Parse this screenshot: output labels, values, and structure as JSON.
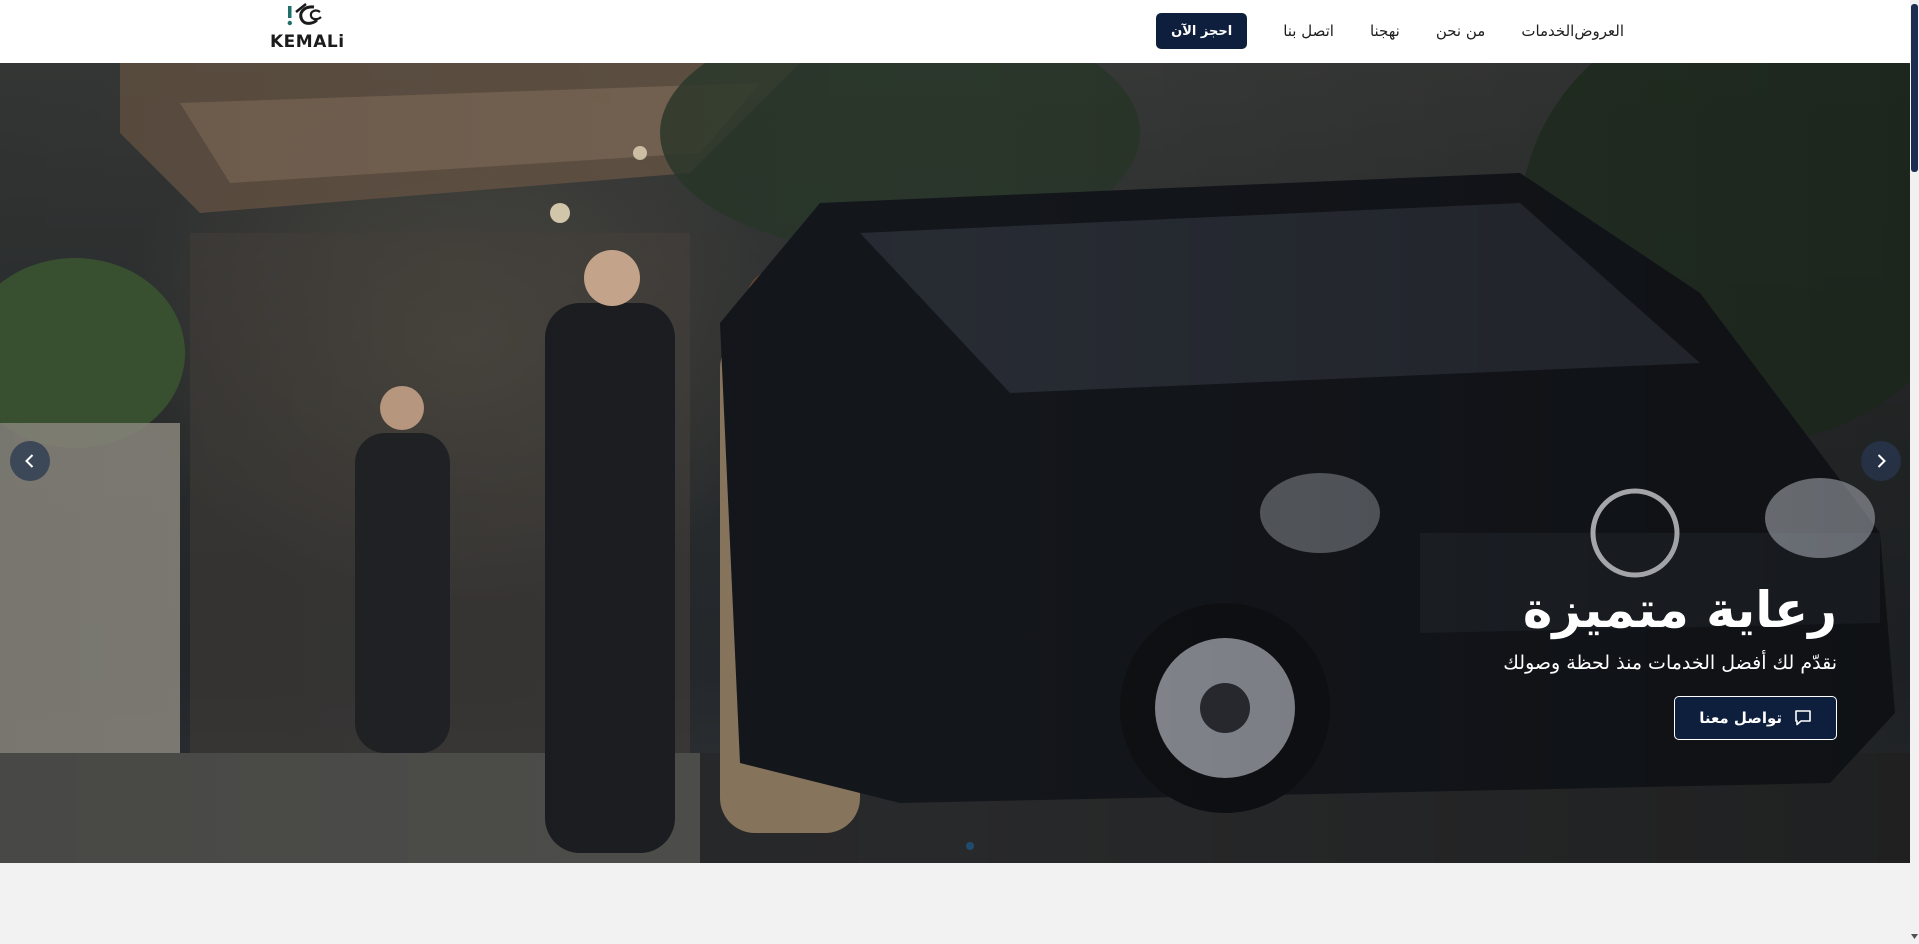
{
  "header": {
    "logo_text": "KEMALi",
    "nav": [
      {
        "label": "العروض"
      },
      {
        "label": "الخدمات"
      },
      {
        "label": "من نحن"
      },
      {
        "label": "نهجنا"
      },
      {
        "label": "اتصل بنا"
      }
    ],
    "cta_label": "احجز الآن"
  },
  "hero": {
    "title": "رعاية متميزة",
    "subtitle": "نقدّم لك أفضل الخدمات منذ لحظة وصولك",
    "button_label": "تواصل معنا",
    "button_icon": "chat-icon",
    "prev_icon": "chevron-left-icon",
    "next_icon": "chevron-right-icon"
  },
  "colors": {
    "brand_navy": "#0e1e3d",
    "header_bg": "#ffffff",
    "page_bg": "#f2f2f2",
    "logo_accent": "#1f6f6a"
  }
}
